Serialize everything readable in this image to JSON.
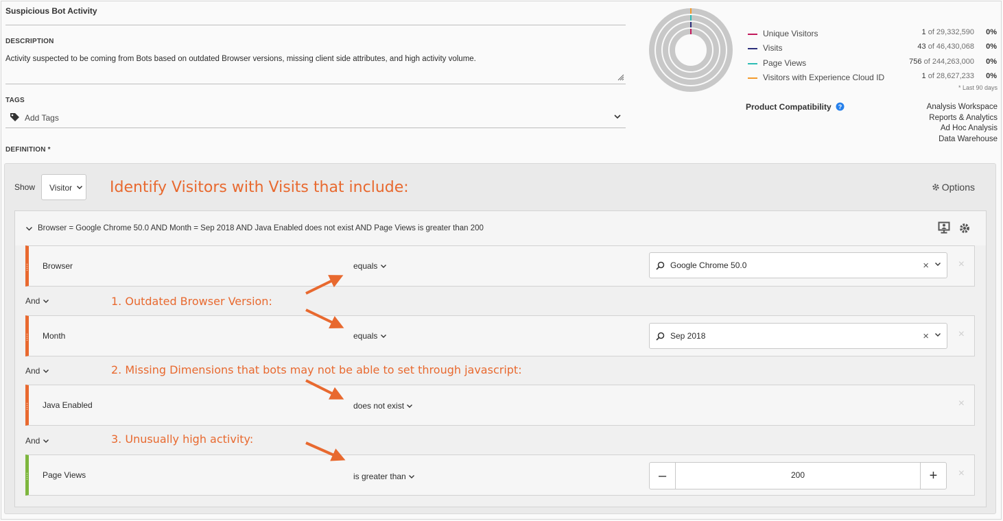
{
  "segment": {
    "title": "Suspicious Bot Activity",
    "description_label": "DESCRIPTION",
    "description": "Activity suspected to be coming from Bots based on outdated  Browser versions, missing client side attributes, and high activity volume.",
    "tags_label": "TAGS",
    "tags_placeholder": "Add Tags",
    "definition_label": "DEFINITION *"
  },
  "summary": {
    "metrics": [
      {
        "name": "Unique Visitors",
        "count": "1",
        "total": "of 29,332,590",
        "pct": "0%",
        "color": "#c2185b"
      },
      {
        "name": "Visits",
        "count": "43",
        "total": "of 46,430,068",
        "pct": "0%",
        "color": "#2b2d7a"
      },
      {
        "name": "Page Views",
        "count": "756",
        "total": "of 244,263,000",
        "pct": "0%",
        "color": "#2bbcb4"
      },
      {
        "name": "Visitors with Experience Cloud ID",
        "count": "1",
        "total": "of 28,627,233",
        "pct": "0%",
        "color": "#f39a2b"
      }
    ],
    "footnote": "* Last 90 days",
    "compat_label": "Product Compatibility",
    "compat_products": [
      "Analysis Workspace",
      "Reports & Analytics",
      "Ad Hoc Analysis",
      "Data Warehouse"
    ]
  },
  "definition": {
    "show_label": "Show",
    "show_value": "Visitor",
    "options_label": "Options",
    "container_summary": "Browser = Google Chrome 50.0 AND Month = Sep 2018 AND Java Enabled does not exist AND Page Views is greater than 200",
    "rules": [
      {
        "dimension": "Browser",
        "operator": "equals",
        "value": "Google Chrome 50.0"
      },
      {
        "dimension": "Month",
        "operator": "equals",
        "value": "Sep 2018"
      },
      {
        "dimension": "Java Enabled",
        "operator": "does not exist"
      },
      {
        "dimension": "Page Views",
        "operator": "is greater than",
        "value": "200"
      }
    ],
    "and_labels": [
      "And",
      "And",
      "And"
    ]
  },
  "annotations": {
    "headline": "Identify Visitors with Visits that include:",
    "note1": "1. Outdated Browser Version:",
    "note2": "2. Missing Dimensions that bots may not be able to set through javascript:",
    "note3": "3. Unusually high activity:",
    "color": "#e8692f"
  }
}
